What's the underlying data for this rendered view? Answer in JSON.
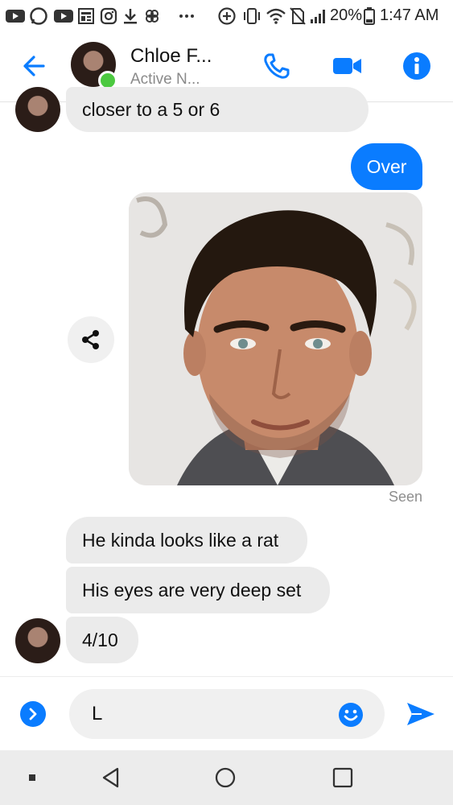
{
  "status_bar": {
    "left_icons": [
      "video-icon",
      "whatsapp-icon",
      "youtube-icon",
      "news-icon",
      "instagram-icon",
      "download-icon",
      "slack-icon",
      "more-dots-icon"
    ],
    "right_icons": [
      "data-saver-icon",
      "vibrate-icon",
      "wifi-icon",
      "no-sim-icon",
      "signal-icon",
      "battery-icon"
    ],
    "battery": "20%",
    "time": "1:47 AM"
  },
  "header": {
    "contact_name": "Chloe F...",
    "contact_status": "Active N...",
    "accent_color": "#0a7cff",
    "online_color": "#4cc940"
  },
  "messages": {
    "m1": "closer to a 5 or 6",
    "m2": "Over",
    "m4": "He kinda looks like a rat",
    "m5": "His eyes are very deep set",
    "m6": "4/10"
  },
  "seen": "Seen",
  "composer": {
    "input_value": "L"
  }
}
